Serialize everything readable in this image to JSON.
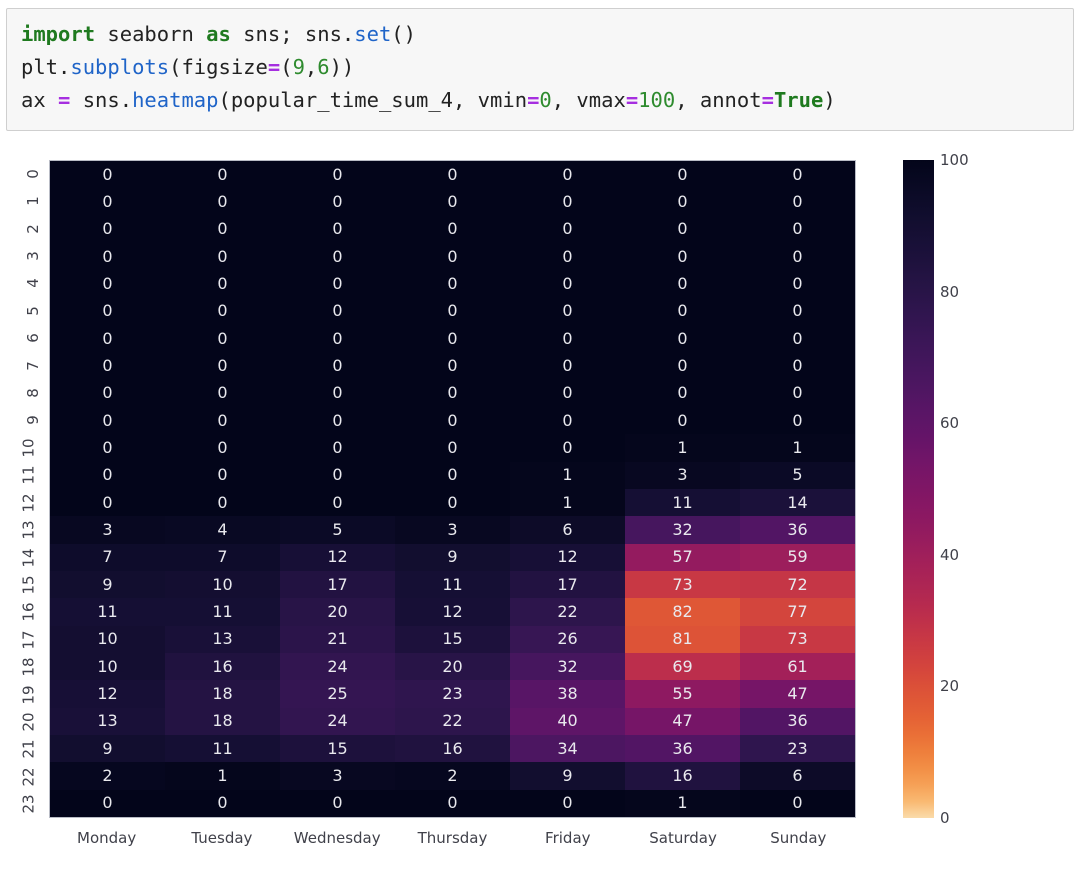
{
  "code_cell": {
    "lines": [
      [
        {
          "t": "import",
          "c": "kw"
        },
        {
          "t": " seaborn ",
          "c": "pl"
        },
        {
          "t": "as",
          "c": "kw"
        },
        {
          "t": " sns; sns.",
          "c": "pl"
        },
        {
          "t": "set",
          "c": "fn"
        },
        {
          "t": "()",
          "c": "pl"
        }
      ],
      [
        {
          "t": "plt.",
          "c": "pl"
        },
        {
          "t": "subplots",
          "c": "fn"
        },
        {
          "t": "(figsize",
          "c": "pl"
        },
        {
          "t": "=",
          "c": "op"
        },
        {
          "t": "(",
          "c": "pl"
        },
        {
          "t": "9",
          "c": "num"
        },
        {
          "t": ",",
          "c": "pl"
        },
        {
          "t": "6",
          "c": "num"
        },
        {
          "t": "))",
          "c": "pl"
        }
      ],
      [
        {
          "t": "ax ",
          "c": "pl"
        },
        {
          "t": "=",
          "c": "op"
        },
        {
          "t": " sns.",
          "c": "pl"
        },
        {
          "t": "heatmap",
          "c": "fn"
        },
        {
          "t": "(popular_time_sum_4, vmin",
          "c": "pl"
        },
        {
          "t": "=",
          "c": "op"
        },
        {
          "t": "0",
          "c": "num"
        },
        {
          "t": ", vmax",
          "c": "pl"
        },
        {
          "t": "=",
          "c": "op"
        },
        {
          "t": "100",
          "c": "num"
        },
        {
          "t": ", annot",
          "c": "pl"
        },
        {
          "t": "=",
          "c": "op"
        },
        {
          "t": "True",
          "c": "bool"
        },
        {
          "t": ")",
          "c": "pl"
        }
      ]
    ],
    "plain_text": [
      "import seaborn as sns; sns.set()",
      "plt.subplots(figsize=(9,6))",
      "ax = sns.heatmap(popular_time_sum_4, vmin=0, vmax=100, annot=True)"
    ]
  },
  "chart_data": {
    "type": "heatmap",
    "title": "",
    "xlabel": "",
    "ylabel": "",
    "grid": false,
    "annot": true,
    "vmin": 0,
    "vmax": 100,
    "colormap": "rocket",
    "legend_position": "right",
    "x_categories": [
      "Monday",
      "Tuesday",
      "Wednesday",
      "Thursday",
      "Friday",
      "Saturday",
      "Sunday"
    ],
    "y_categories": [
      "0",
      "1",
      "2",
      "3",
      "4",
      "5",
      "6",
      "7",
      "8",
      "9",
      "10",
      "11",
      "12",
      "13",
      "14",
      "15",
      "16",
      "17",
      "18",
      "19",
      "20",
      "21",
      "22",
      "23"
    ],
    "colorbar_ticks": [
      100,
      80,
      60,
      40,
      20,
      0
    ],
    "values": [
      [
        0,
        0,
        0,
        0,
        0,
        0,
        0
      ],
      [
        0,
        0,
        0,
        0,
        0,
        0,
        0
      ],
      [
        0,
        0,
        0,
        0,
        0,
        0,
        0
      ],
      [
        0,
        0,
        0,
        0,
        0,
        0,
        0
      ],
      [
        0,
        0,
        0,
        0,
        0,
        0,
        0
      ],
      [
        0,
        0,
        0,
        0,
        0,
        0,
        0
      ],
      [
        0,
        0,
        0,
        0,
        0,
        0,
        0
      ],
      [
        0,
        0,
        0,
        0,
        0,
        0,
        0
      ],
      [
        0,
        0,
        0,
        0,
        0,
        0,
        0
      ],
      [
        0,
        0,
        0,
        0,
        0,
        0,
        0
      ],
      [
        0,
        0,
        0,
        0,
        0,
        1,
        1
      ],
      [
        0,
        0,
        0,
        0,
        1,
        3,
        5
      ],
      [
        0,
        0,
        0,
        0,
        1,
        11,
        14
      ],
      [
        3,
        4,
        5,
        3,
        6,
        32,
        36
      ],
      [
        7,
        7,
        12,
        9,
        12,
        57,
        59
      ],
      [
        9,
        10,
        17,
        11,
        17,
        73,
        72
      ],
      [
        11,
        11,
        20,
        12,
        22,
        82,
        77
      ],
      [
        10,
        13,
        21,
        15,
        26,
        81,
        73
      ],
      [
        10,
        16,
        24,
        20,
        32,
        69,
        61
      ],
      [
        12,
        18,
        25,
        23,
        38,
        55,
        47
      ],
      [
        13,
        18,
        24,
        22,
        40,
        47,
        36
      ],
      [
        9,
        11,
        15,
        16,
        34,
        36,
        23
      ],
      [
        2,
        1,
        3,
        2,
        9,
        16,
        6
      ],
      [
        0,
        0,
        0,
        0,
        0,
        1,
        0
      ]
    ]
  },
  "colors": {
    "figure_background": "#ffffff",
    "code_background": "#f7f7f7",
    "code_border": "#cfcfcf",
    "tick_label": "#40414a",
    "axes_border": "#b9bcc6",
    "keyword": "#1f7a1f",
    "function": "#1f64c8",
    "number": "#2e8b2e",
    "operator": "#a62fe0"
  }
}
